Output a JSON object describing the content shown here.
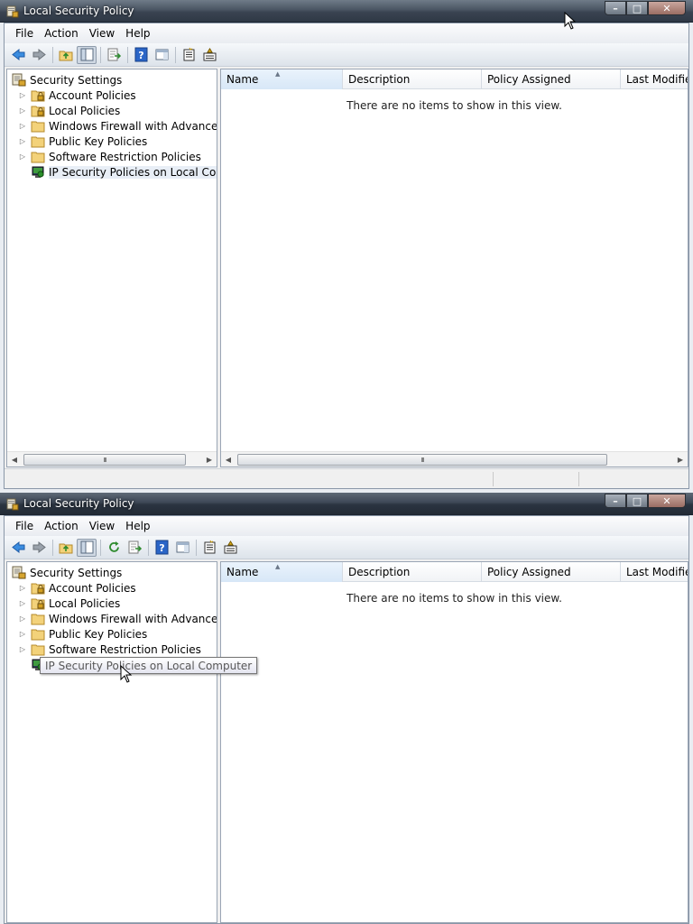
{
  "window": {
    "title": "Local Security Policy",
    "controls": {
      "minimize": "–",
      "maximize": "□",
      "close": "✕"
    }
  },
  "menu": [
    "File",
    "Action",
    "View",
    "Help"
  ],
  "tree": {
    "root": "Security Settings",
    "items": [
      {
        "label": "Account Policies",
        "icon": "locked-folder-icon"
      },
      {
        "label": "Local Policies",
        "icon": "locked-folder-icon"
      },
      {
        "label": "Windows Firewall with Advanced Security",
        "icon": "folder-icon"
      },
      {
        "label": "Public Key Policies",
        "icon": "folder-icon"
      },
      {
        "label": "Software Restriction Policies",
        "icon": "folder-icon"
      },
      {
        "label": "IP Security Policies on Local Computer",
        "icon": "ip-security-icon"
      }
    ]
  },
  "list": {
    "columns": [
      "Name",
      "Description",
      "Policy Assigned",
      "Last Modified"
    ],
    "empty_message": "There are no items to show in this view."
  },
  "tooltip": "IP Security Policies on Local Computer",
  "scroll_glyph": "III",
  "colors": {
    "titlebar": "#3a4452",
    "accent": "#1f6fd1",
    "folder": "#f3d27a"
  }
}
